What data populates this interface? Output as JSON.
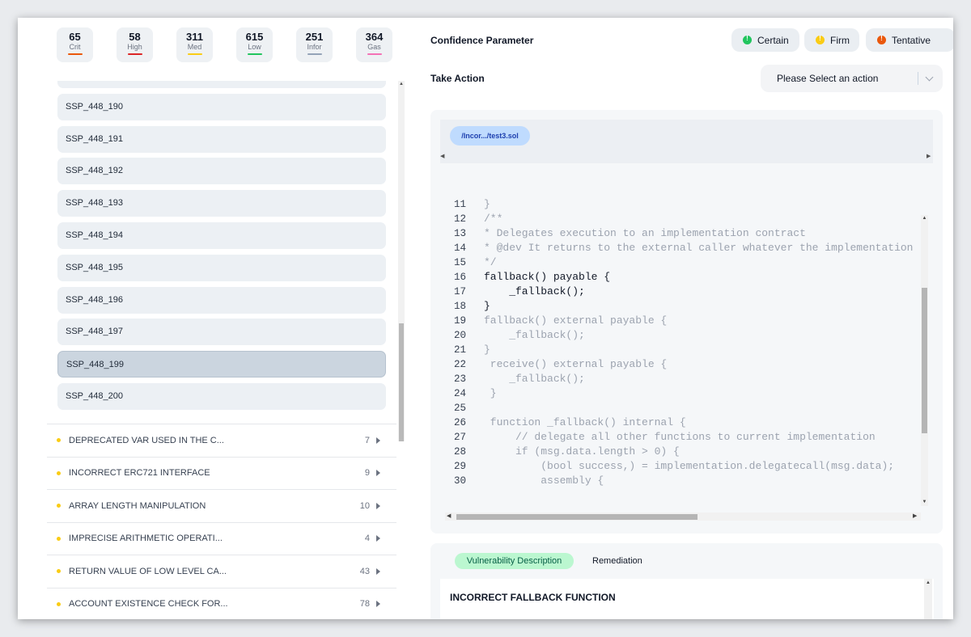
{
  "stats": [
    {
      "value": "65",
      "label": "Crit",
      "color": "#ea580c"
    },
    {
      "value": "58",
      "label": "High",
      "color": "#dc2626"
    },
    {
      "value": "311",
      "label": "Med",
      "color": "#facc15"
    },
    {
      "value": "615",
      "label": "Low",
      "color": "#22c55e"
    },
    {
      "value": "251",
      "label": "Infor",
      "color": "#94a3b8"
    },
    {
      "value": "364",
      "label": "Gas",
      "color": "#f472b6"
    }
  ],
  "instances": [
    {
      "label": ""
    },
    {
      "label": "SSP_448_190"
    },
    {
      "label": "SSP_448_191"
    },
    {
      "label": "SSP_448_192"
    },
    {
      "label": "SSP_448_193"
    },
    {
      "label": "SSP_448_194"
    },
    {
      "label": "SSP_448_195"
    },
    {
      "label": "SSP_448_196"
    },
    {
      "label": "SSP_448_197"
    },
    {
      "label": "SSP_448_199",
      "selected": true
    },
    {
      "label": "SSP_448_200"
    }
  ],
  "vulnerabilities": [
    {
      "name": "DEPRECATED VAR USED IN THE C...",
      "count": "7"
    },
    {
      "name": "INCORRECT ERC721 INTERFACE",
      "count": "9"
    },
    {
      "name": "ARRAY LENGTH MANIPULATION",
      "count": "10"
    },
    {
      "name": "IMPRECISE ARITHMETIC OPERATI...",
      "count": "4"
    },
    {
      "name": "RETURN VALUE OF LOW LEVEL CA...",
      "count": "43"
    },
    {
      "name": "ACCOUNT EXISTENCE CHECK FOR...",
      "count": "78"
    }
  ],
  "confidence": {
    "label": "Confidence Parameter",
    "options": [
      {
        "label": "Certain",
        "color": "#22c55e"
      },
      {
        "label": "Firm",
        "color": "#facc15"
      },
      {
        "label": "Tentative",
        "color": "#ea580c"
      }
    ]
  },
  "action": {
    "label": "Take Action",
    "placeholder": "Please Select an action"
  },
  "file_tab": "/Incor.../test3.sol",
  "code": [
    {
      "n": "11",
      "t": "}",
      "hl": false
    },
    {
      "n": "12",
      "t": "/**",
      "hl": false
    },
    {
      "n": "13",
      "t": "* Delegates execution to an implementation contract",
      "hl": false
    },
    {
      "n": "14",
      "t": "* @dev It returns to the external caller whatever the implementation",
      "hl": false
    },
    {
      "n": "15",
      "t": "*/",
      "hl": false
    },
    {
      "n": "16",
      "t": "fallback() payable {",
      "hl": true
    },
    {
      "n": "17",
      "t": "    _fallback();",
      "hl": true
    },
    {
      "n": "18",
      "t": "}",
      "hl": true
    },
    {
      "n": "19",
      "t": "fallback() external payable {",
      "hl": false
    },
    {
      "n": "20",
      "t": "    _fallback();",
      "hl": false
    },
    {
      "n": "21",
      "t": "}",
      "hl": false
    },
    {
      "n": "22",
      "t": " receive() external payable {",
      "hl": false
    },
    {
      "n": "23",
      "t": "    _fallback();",
      "hl": false
    },
    {
      "n": "24",
      "t": " }",
      "hl": false
    },
    {
      "n": "25",
      "t": "",
      "hl": false
    },
    {
      "n": "26",
      "t": " function _fallback() internal {",
      "hl": false
    },
    {
      "n": "27",
      "t": "     // delegate all other functions to current implementation",
      "hl": false
    },
    {
      "n": "28",
      "t": "     if (msg.data.length > 0) {",
      "hl": false
    },
    {
      "n": "29",
      "t": "         (bool success,) = implementation.delegatecall(msg.data);",
      "hl": false
    },
    {
      "n": "30",
      "t": "         assembly {",
      "hl": false
    }
  ],
  "description": {
    "tab_active": "Vulnerability Description",
    "tab_other": "Remediation",
    "title": "INCORRECT FALLBACK FUNCTION"
  }
}
